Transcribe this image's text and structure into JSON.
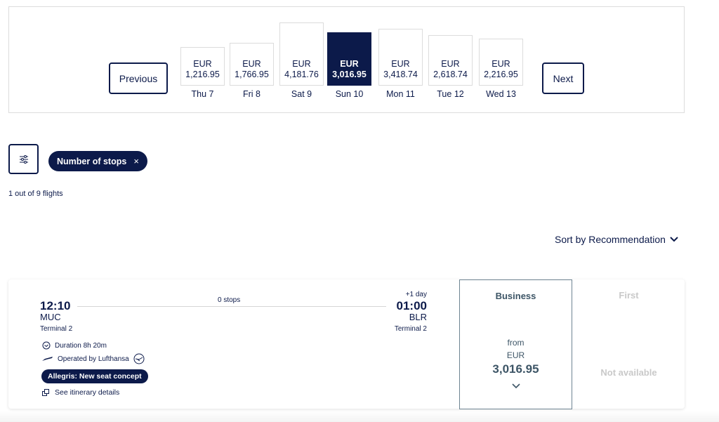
{
  "date_strip": {
    "previous_label": "Previous",
    "next_label": "Next",
    "days": [
      {
        "currency": "EUR",
        "price": "1,216.95",
        "label": "Thu 7",
        "relative_price": 0.29,
        "selected": false
      },
      {
        "currency": "EUR",
        "price": "1,766.95",
        "label": "Fri 8",
        "relative_price": 0.42,
        "selected": false
      },
      {
        "currency": "EUR",
        "price": "4,181.76",
        "label": "Sat 9",
        "relative_price": 1.0,
        "selected": false
      },
      {
        "currency": "EUR",
        "price": "3,016.95",
        "label": "Sun 10",
        "relative_price": 0.72,
        "selected": true
      },
      {
        "currency": "EUR",
        "price": "3,418.74",
        "label": "Mon 11",
        "relative_price": 0.82,
        "selected": false
      },
      {
        "currency": "EUR",
        "price": "2,618.74",
        "label": "Tue 12",
        "relative_price": 0.63,
        "selected": false
      },
      {
        "currency": "EUR",
        "price": "2,216.95",
        "label": "Wed 13",
        "relative_price": 0.53,
        "selected": false
      }
    ]
  },
  "filters": {
    "filter_icon": "sliders-icon",
    "chip_label": "Number of stops",
    "chip_remove": "×"
  },
  "results_count": "1 out of 9 flights",
  "sort": {
    "label": "Sort by Recommendation",
    "icon": "chevron-down-icon"
  },
  "flight": {
    "departure": {
      "time": "12:10",
      "airport": "MUC",
      "terminal": "Terminal 2"
    },
    "arrival": {
      "time": "01:00",
      "airport": "BLR",
      "terminal": "Terminal 2",
      "day_offset": "+1 day"
    },
    "stops": "0 stops",
    "duration": "Duration 8h 20m",
    "operated_by": "Operated by Lufthansa",
    "badge": "Allegris: New seat concept",
    "itinerary_link": "See itinerary details",
    "fares": {
      "business": {
        "title": "Business",
        "from": "from",
        "currency": "EUR",
        "price": "3,016.95"
      },
      "first": {
        "title": "First",
        "status": "Not available"
      }
    }
  },
  "colors": {
    "brand": "#0c1a4a",
    "fare_text": "#3d5566",
    "disabled": "#c9c9c9",
    "border": "#dcdcdc"
  }
}
